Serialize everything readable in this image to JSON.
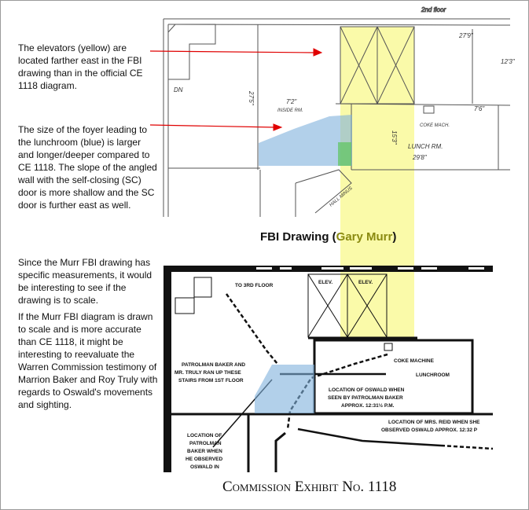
{
  "notes": [
    "The elevators (yellow) are located farther east in the FBI drawing than in the official CE 1118 diagram.",
    "The size of the foyer leading to the lunchroom (blue) is larger and longer/deeper compared to CE 1118. The slope of the angled wall with the self-closing (SC) door is more shallow and the SC door is further east as well.",
    "Since the Murr FBI drawing has specific measurements, it would be interesting to see if the drawing is to scale.",
    "If the Murr FBI diagram is drawn to scale and is more accurate than CE 1118, it might be interesting to reevaluate the Warren Commission testimony of Marrion Baker and Roy Truly with regards to Oswald's movements and sighting."
  ],
  "fbi_caption": {
    "prefix": "FBI Drawing (",
    "name": "Gary Murr",
    "suffix": ")"
  },
  "ce_caption": "Commission Exhibit No. 1118",
  "fbi_drawing": {
    "floor": "2nd floor",
    "dn": "DN",
    "dim_27_9": "27'9\"",
    "dim_12_3": "12'3\"",
    "dim_27_5": "27'5\"",
    "dim_7_2": "7'2\"",
    "inside_rm": "INSIDE RM.",
    "dim_15_3": "15'3\"",
    "dim_29_8": "29'8\"",
    "dim_7_6": "7'6\"",
    "lunch_rm": "LUNCH RM.",
    "coke": "COKE MACH.",
    "hall_minus": "HALL MINUS"
  },
  "ce_drawing": {
    "to_3rd": "TO 3RD FLOOR",
    "elev1": "ELEV.",
    "elev2": "ELEV.",
    "coke": "COKE MACHINE",
    "lunchroom": "LUNCHROOM",
    "stairs_note": [
      "PATROLMAN BAKER AND",
      "MR. TRULY RAN UP THESE",
      "STAIRS FROM 1ST FLOOR"
    ],
    "oswald_note": [
      "LOCATION OF OSWALD WHEN",
      "SEEN BY PATROLMAN BAKER",
      "APPROX. 12:31½ P.M."
    ],
    "reid_note": [
      "LOCATION OF MRS. REID WHEN SHE",
      "OBSERVED OSWALD APPROX. 12:32 P"
    ],
    "baker_note": [
      "LOCATION OF",
      "PATROLMAN",
      "BAKER WHEN",
      "HE OBSERVED",
      "OSWALD IN"
    ]
  },
  "colors": {
    "elevator_highlight": "#fafaa0",
    "foyer_highlight": "#a9c9e6",
    "door_highlight": "#7ccf7c",
    "arrow": "#e00000",
    "murr": "#8a8a10"
  }
}
